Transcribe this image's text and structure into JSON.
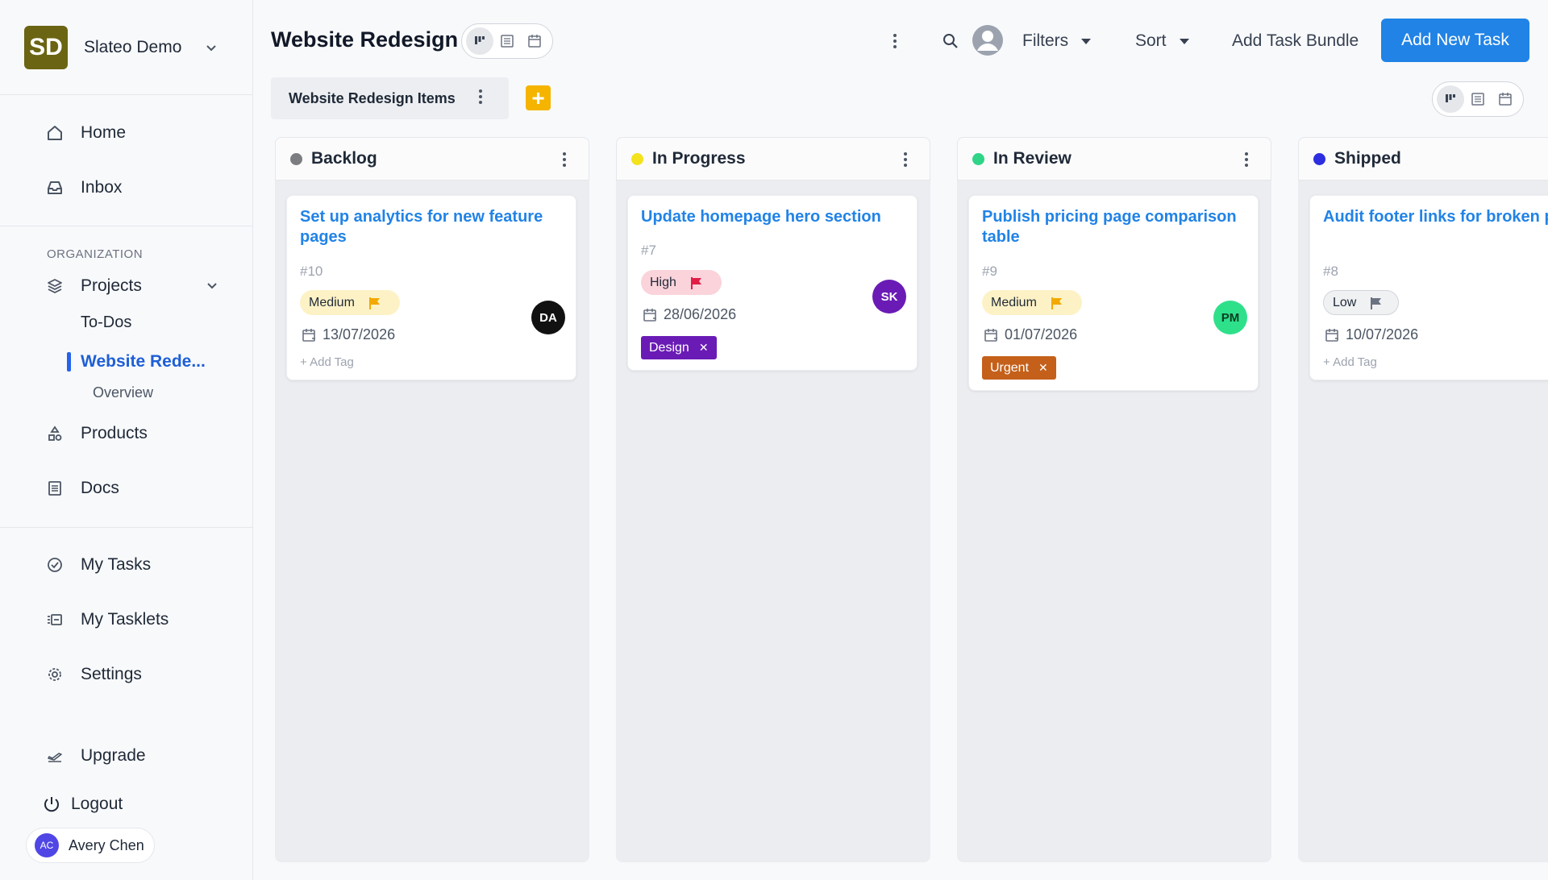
{
  "workspace": {
    "logo_text": "SD",
    "name": "Slateo Demo"
  },
  "sidebar": {
    "home": "Home",
    "inbox": "Inbox",
    "org_label": "ORGANIZATION",
    "projects": "Projects",
    "todos": "To-Dos",
    "active_project": "Website Rede...",
    "overview": "Overview",
    "products": "Products",
    "docs": "Docs",
    "my_tasks": "My Tasks",
    "my_tasklets": "My Tasklets",
    "settings": "Settings",
    "upgrade": "Upgrade",
    "logout": "Logout",
    "user": {
      "initials": "AC",
      "name": "Avery Chen"
    }
  },
  "header": {
    "title": "Website Redesign",
    "filters": "Filters",
    "sort": "Sort",
    "add_bundle": "Add Task Bundle",
    "add_task": "Add New Task"
  },
  "bundle": {
    "label": "Website Redesign Items",
    "add": "+"
  },
  "columns": [
    {
      "title": "Backlog",
      "dot_color": "#7b7d80",
      "card": {
        "title": "Set up analytics for new feature pages",
        "id": "#10",
        "priority": "Medium",
        "date": "13/07/2026",
        "add_tag": "+ Add Tag",
        "assignee": "DA"
      }
    },
    {
      "title": "In Progress",
      "dot_color": "#f3e21c",
      "card": {
        "title": "Update homepage hero section",
        "id": "#7",
        "priority": "High",
        "date": "28/06/2026",
        "tag": "Design",
        "assignee": "SK"
      }
    },
    {
      "title": "In Review",
      "dot_color": "#2fd487",
      "card": {
        "title": "Publish pricing page comparison table",
        "id": "#9",
        "priority": "Medium",
        "date": "01/07/2026",
        "tag": "Urgent",
        "assignee": "PM"
      }
    },
    {
      "title": "Shipped",
      "dot_color": "#2d2ee0",
      "card": {
        "title": "Audit footer links for broken paths",
        "id": "#8",
        "priority": "Low",
        "date": "10/07/2026",
        "add_tag": "+ Add Tag"
      }
    }
  ],
  "colors": {
    "accent": "#2183e6",
    "medium_bg": "#fdf2c6",
    "medium_flag": "#f2a900",
    "high_bg": "#fbd3db",
    "high_flag": "#e11d48",
    "low_bg": "#f0f1f3",
    "low_flag": "#6b7280",
    "tag_design": "#6a1bb5",
    "tag_urgent": "#c4601a",
    "avatar_da": "#111111",
    "avatar_sk": "#6a1bb5",
    "avatar_pm": "#2fe08b"
  }
}
